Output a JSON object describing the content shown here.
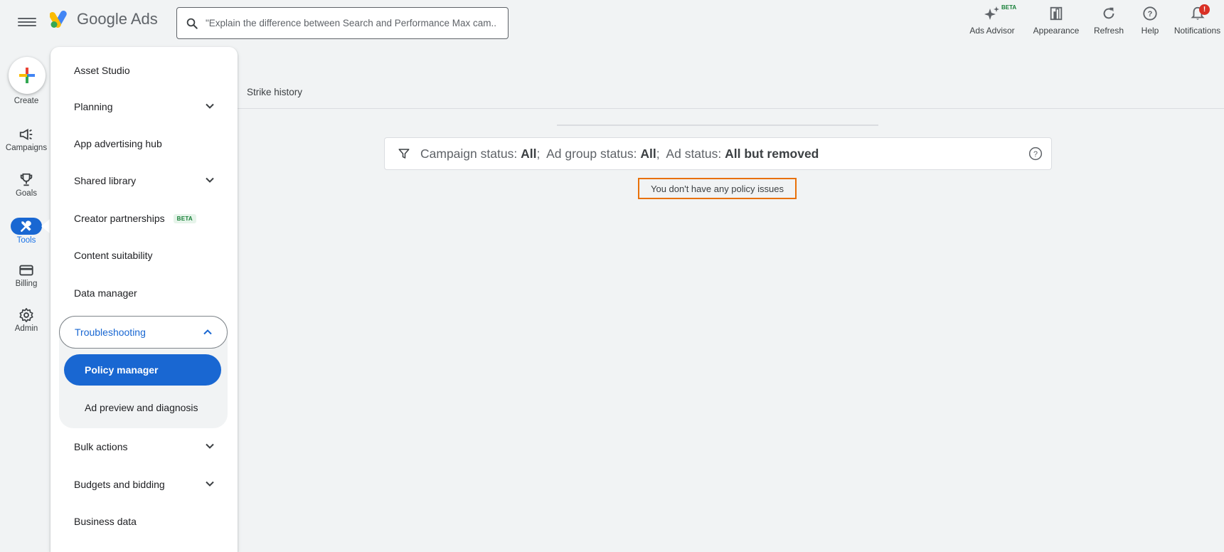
{
  "header": {
    "app_name": "Google Ads",
    "search_placeholder": "\"Explain the difference between Search and Performance Max cam...",
    "actions": [
      {
        "label": "Ads Advisor",
        "icon": "sparkle-icon",
        "badge": "BETA"
      },
      {
        "label": "Appearance",
        "icon": "appearance-icon"
      },
      {
        "label": "Refresh",
        "icon": "refresh-icon"
      },
      {
        "label": "Help",
        "icon": "help-icon"
      },
      {
        "label": "Notifications",
        "icon": "bell-icon",
        "badge": "!"
      }
    ]
  },
  "rail": {
    "create_label": "Create",
    "items": [
      {
        "label": "Campaigns",
        "icon": "megaphone-icon"
      },
      {
        "label": "Goals",
        "icon": "trophy-icon"
      },
      {
        "label": "Tools",
        "icon": "tools-icon",
        "active": true
      },
      {
        "label": "Billing",
        "icon": "card-icon"
      },
      {
        "label": "Admin",
        "icon": "gear-icon"
      }
    ]
  },
  "menu": {
    "asset_studio": "Asset Studio",
    "planning": "Planning",
    "app_hub": "App advertising hub",
    "shared_library": "Shared library",
    "creator_partnerships": "Creator partnerships",
    "creator_beta": "BETA",
    "content_suitability": "Content suitability",
    "data_manager": "Data manager",
    "troubleshooting": "Troubleshooting",
    "policy_manager": "Policy manager",
    "ad_preview": "Ad preview and diagnosis",
    "bulk_actions": "Bulk actions",
    "budgets_bidding": "Budgets and bidding",
    "business_data": "Business data"
  },
  "main": {
    "tab_strike_history": "Strike history",
    "filter": {
      "campaign_label": "Campaign status:",
      "campaign_value": "All",
      "adgroup_label": "Ad group status:",
      "adgroup_value": "All",
      "ad_label": "Ad status:",
      "ad_value": "All but removed",
      "sep": ";"
    },
    "empty_message": "You don't have any policy issues"
  },
  "colors": {
    "accent": "#1967d2",
    "highlight": "#e8710a",
    "background": "#f1f3f4"
  }
}
